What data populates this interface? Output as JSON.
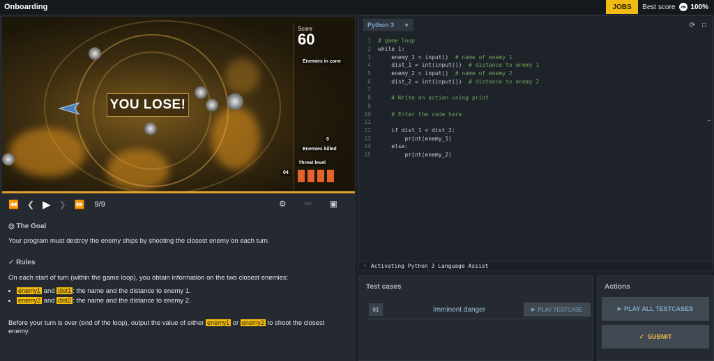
{
  "header": {
    "title": "Onboarding",
    "jobs_label": "JOBS",
    "best_score_label": "Best score",
    "best_score_value": "100%"
  },
  "game": {
    "score_label": "Score",
    "score_value": "60",
    "result": "YOU LOSE!",
    "enemies_in_zone_label": "Enemies in zone",
    "enemies_killed_label": "Enemies killed",
    "enemies_killed_value": "0",
    "threat_label": "Threat level",
    "threat_value": "04"
  },
  "player": {
    "frame": "9/9"
  },
  "goal": {
    "heading": "The Goal",
    "text": "Your program must destroy the enemy ships by shooting the closest enemy on each turn."
  },
  "rules": {
    "heading": "Rules",
    "intro": "On each start of turn (within the game loop), you obtain information on the two closest enemies:",
    "items": [
      {
        "a": "enemy1",
        "and": "and",
        "b": "dist1",
        "rest": ": the name and the distance to enemy 1."
      },
      {
        "a": "enemy2",
        "and": "and",
        "b": "dist2",
        "rest": ": the name and the distance to enemy 2."
      }
    ],
    "outro_1": "Before your turn is over (end of the loop), output the value of either",
    "outro_tag1": "enemy1",
    "outro_or": "or",
    "outro_tag2": "enemy2",
    "outro_2": "to shoot the closest enemy."
  },
  "editor": {
    "language": "Python 3",
    "status": "Activating Python 3 Language Assist",
    "lines": [
      {
        "n": "1",
        "code": "# game loop",
        "type": "cm"
      },
      {
        "n": "2",
        "code": "while 1:",
        "type": "kw"
      },
      {
        "n": "3",
        "code": "    enemy_1 = input()  # name of enemy 1",
        "type": "mix"
      },
      {
        "n": "4",
        "code": "    dist_1 = int(input())  # distance to enemy 1",
        "type": "mix"
      },
      {
        "n": "5",
        "code": "    enemy_2 = input()  # name of enemy 2",
        "type": "mix"
      },
      {
        "n": "6",
        "code": "    dist_2 = int(input())  # distance to enemy 2",
        "type": "mix"
      },
      {
        "n": "7",
        "code": "",
        "type": "kw"
      },
      {
        "n": "8",
        "code": "    # Write an action using print",
        "type": "cm"
      },
      {
        "n": "9",
        "code": "",
        "type": "kw"
      },
      {
        "n": "10",
        "code": "    # Enter the code here",
        "type": "cm"
      },
      {
        "n": "11",
        "code": "",
        "type": "kw"
      },
      {
        "n": "12",
        "code": "    if dist_1 < dist_2:",
        "type": "kw"
      },
      {
        "n": "13",
        "code": "        print(enemy_1)",
        "type": "kw"
      },
      {
        "n": "14",
        "code": "    else:",
        "type": "kw"
      },
      {
        "n": "15",
        "code": "        print(enemy_2)",
        "type": "kw"
      }
    ]
  },
  "testcases": {
    "heading": "Test cases",
    "items": [
      {
        "num": "01",
        "name": "Imminent danger",
        "button": "PLAY TESTCASE"
      }
    ]
  },
  "actions": {
    "heading": "Actions",
    "play_all": "PLAY ALL TESTCASES",
    "submit": "SUBMIT"
  },
  "colors": {
    "accent": "#f2bb13",
    "threat": "#e4632b"
  }
}
